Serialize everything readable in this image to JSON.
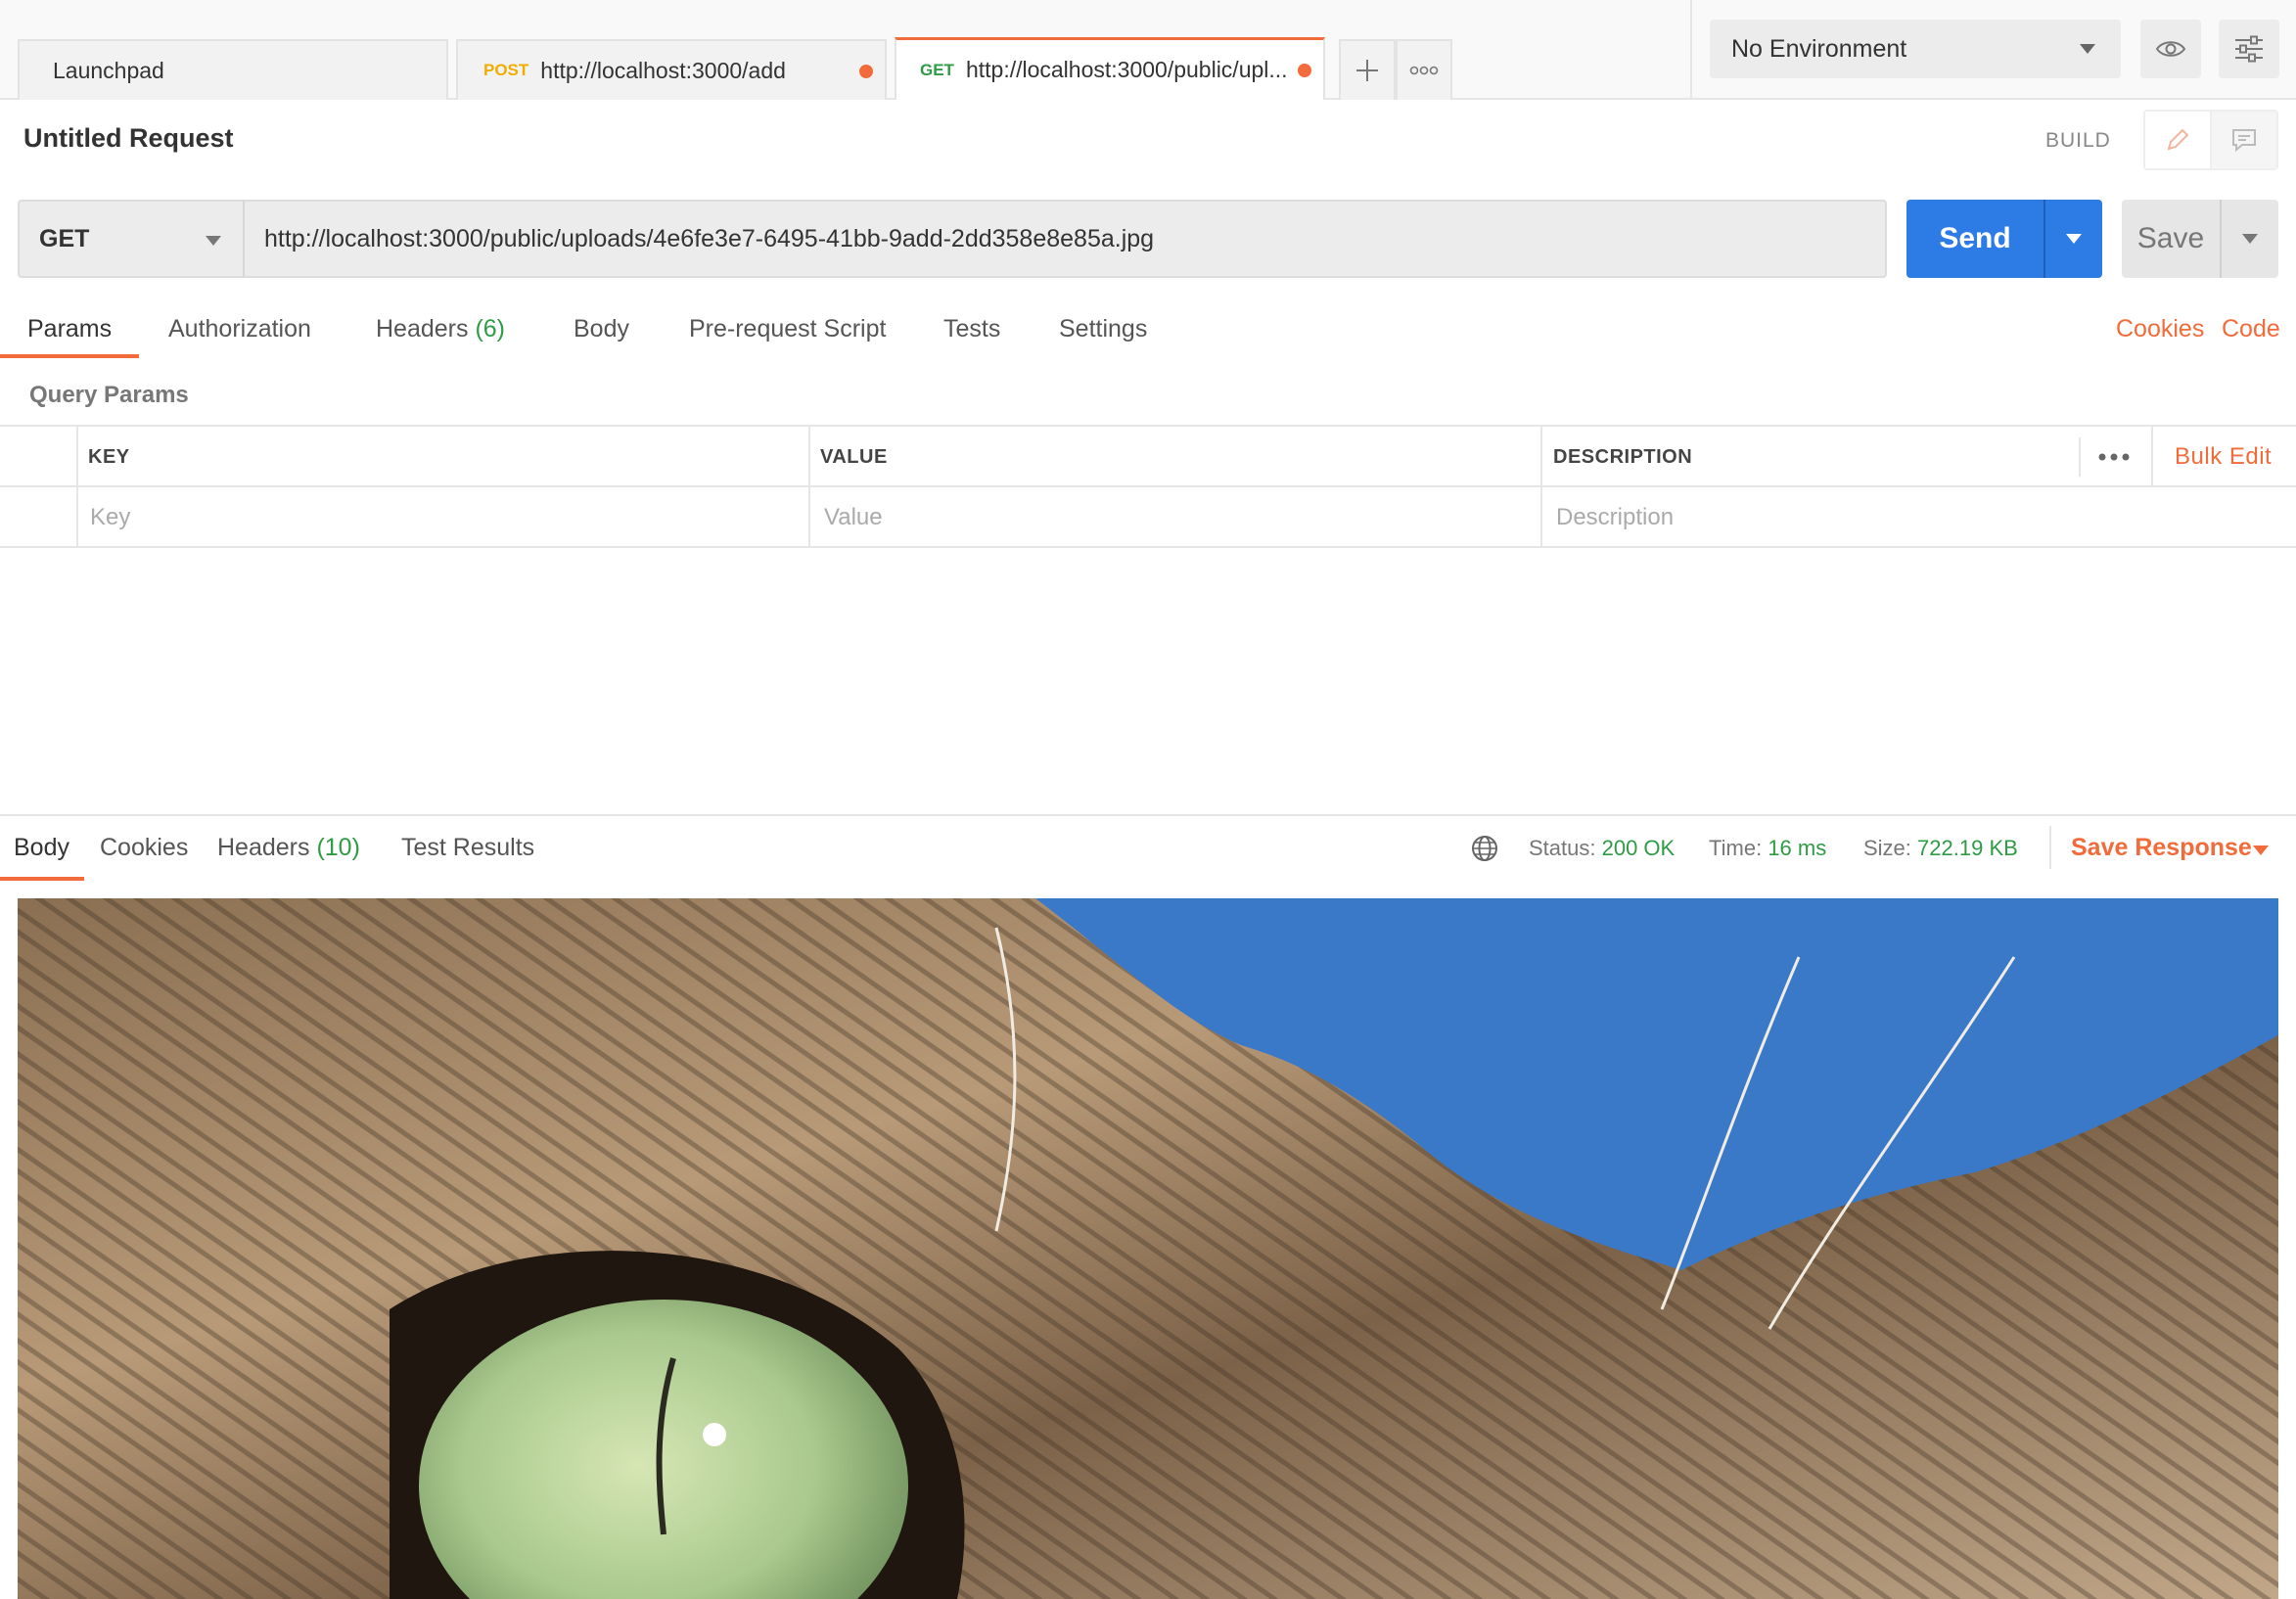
{
  "tabs": [
    {
      "label": "Launchpad",
      "method": "",
      "url": ""
    },
    {
      "method": "POST",
      "url": "http://localhost:3000/add",
      "unsaved": true
    },
    {
      "method": "GET",
      "url": "http://localhost:3000/public/upl...",
      "unsaved": true,
      "active": true
    }
  ],
  "environment": {
    "selected": "No Environment"
  },
  "request": {
    "title": "Untitled Request",
    "mode_label": "BUILD",
    "method": "GET",
    "url": "http://localhost:3000/public/uploads/4e6fe3e7-6495-41bb-9add-2dd358e8e85a.jpg",
    "send_label": "Send",
    "save_label": "Save"
  },
  "request_tabs": {
    "params": "Params",
    "authorization": "Authorization",
    "headers": "Headers",
    "headers_count": "(6)",
    "body": "Body",
    "prerequest": "Pre-request Script",
    "tests": "Tests",
    "settings": "Settings",
    "cookies": "Cookies",
    "code": "Code"
  },
  "query_params": {
    "label": "Query Params",
    "columns": {
      "key": "KEY",
      "value": "VALUE",
      "description": "DESCRIPTION"
    },
    "bulk_edit": "Bulk Edit",
    "placeholders": {
      "key": "Key",
      "value": "Value",
      "description": "Description"
    }
  },
  "response": {
    "tabs": {
      "body": "Body",
      "cookies": "Cookies",
      "headers": "Headers",
      "headers_count": "(10)",
      "test_results": "Test Results"
    },
    "status_label": "Status:",
    "status": "200 OK",
    "time_label": "Time:",
    "time": "16 ms",
    "size_label": "Size:",
    "size": "722.19 KB",
    "save_response": "Save Response"
  },
  "colors": {
    "accent": "#f26b3a",
    "send": "#2d7be5",
    "success": "#2f9b45",
    "post_method": "#f0ad00"
  },
  "icons": [
    "plus-icon",
    "more-icon",
    "eye-icon",
    "settings-sliders-icon",
    "pencil-icon",
    "comment-icon",
    "globe-icon",
    "caret-down-icon"
  ]
}
